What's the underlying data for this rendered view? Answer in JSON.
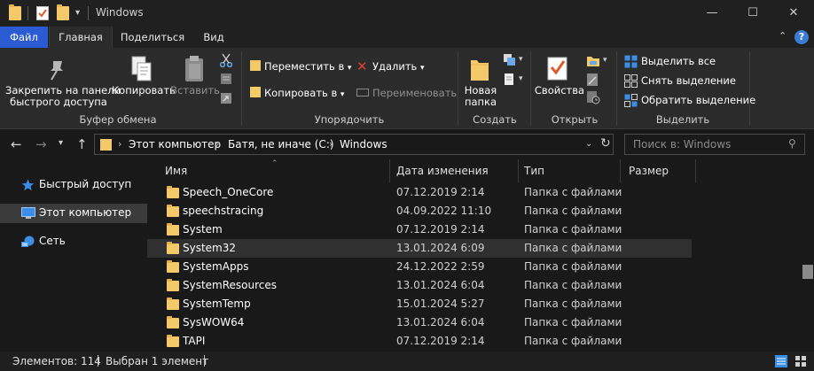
{
  "window": {
    "title": "Windows"
  },
  "tabs": {
    "file": "Файл",
    "home": "Главная",
    "share": "Поделиться",
    "view": "Вид"
  },
  "ribbon": {
    "clipboard": {
      "pin_label": [
        "Закрепить на панели",
        "быстрого доступа"
      ],
      "copy_label": "Копировать",
      "paste_label": "Вставить",
      "group": "Буфер обмена"
    },
    "organize": {
      "move": "Переместить в",
      "copy_to": "Копировать в",
      "delete": "Удалить",
      "rename": "Переименовать",
      "group": "Упорядочить"
    },
    "new": {
      "new_folder": [
        "Новая",
        "папка"
      ],
      "group": "Создать"
    },
    "open": {
      "properties": "Свойства",
      "group": "Открыть"
    },
    "select": {
      "select_all": "Выделить все",
      "select_none": "Снять выделение",
      "invert": "Обратить выделение",
      "group": "Выделить"
    }
  },
  "address": {
    "crumbs": [
      "Этот компьютер",
      "Батя, не иначе (C:)",
      "Windows"
    ],
    "search_placeholder": "Поиск в: Windows"
  },
  "nav": {
    "items": [
      {
        "label": "Быстрый доступ",
        "icon": "star-icon"
      },
      {
        "label": "Этот компьютер",
        "icon": "computer-icon",
        "selected": true
      },
      {
        "label": "Сеть",
        "icon": "network-icon"
      }
    ]
  },
  "list": {
    "columns": {
      "name": "Имя",
      "date": "Дата изменения",
      "type": "Тип",
      "size": "Размер"
    },
    "rows": [
      {
        "name": "Speech_OneCore",
        "date": "07.12.2019 2:14",
        "type": "Папка с файлами"
      },
      {
        "name": "speechstracing",
        "date": "04.09.2022 11:10",
        "type": "Папка с файлами"
      },
      {
        "name": "System",
        "date": "07.12.2019 2:14",
        "type": "Папка с файлами"
      },
      {
        "name": "System32",
        "date": "13.01.2024 6:09",
        "type": "Папка с файлами",
        "selected": true
      },
      {
        "name": "SystemApps",
        "date": "24.12.2022 2:59",
        "type": "Папка с файлами"
      },
      {
        "name": "SystemResources",
        "date": "13.01.2024 6:04",
        "type": "Папка с файлами"
      },
      {
        "name": "SystemTemp",
        "date": "15.01.2024 5:27",
        "type": "Папка с файлами"
      },
      {
        "name": "SysWOW64",
        "date": "13.01.2024 6:04",
        "type": "Папка с файлами"
      },
      {
        "name": "TAPI",
        "date": "07.12.2019 2:14",
        "type": "Папка с файлами"
      }
    ]
  },
  "status": {
    "count": "Элементов: 114",
    "selected": "Выбран 1 элемент"
  },
  "colors": {
    "accent": "#2a5bd3",
    "folder": "#f4c96a",
    "background": "#191919"
  }
}
